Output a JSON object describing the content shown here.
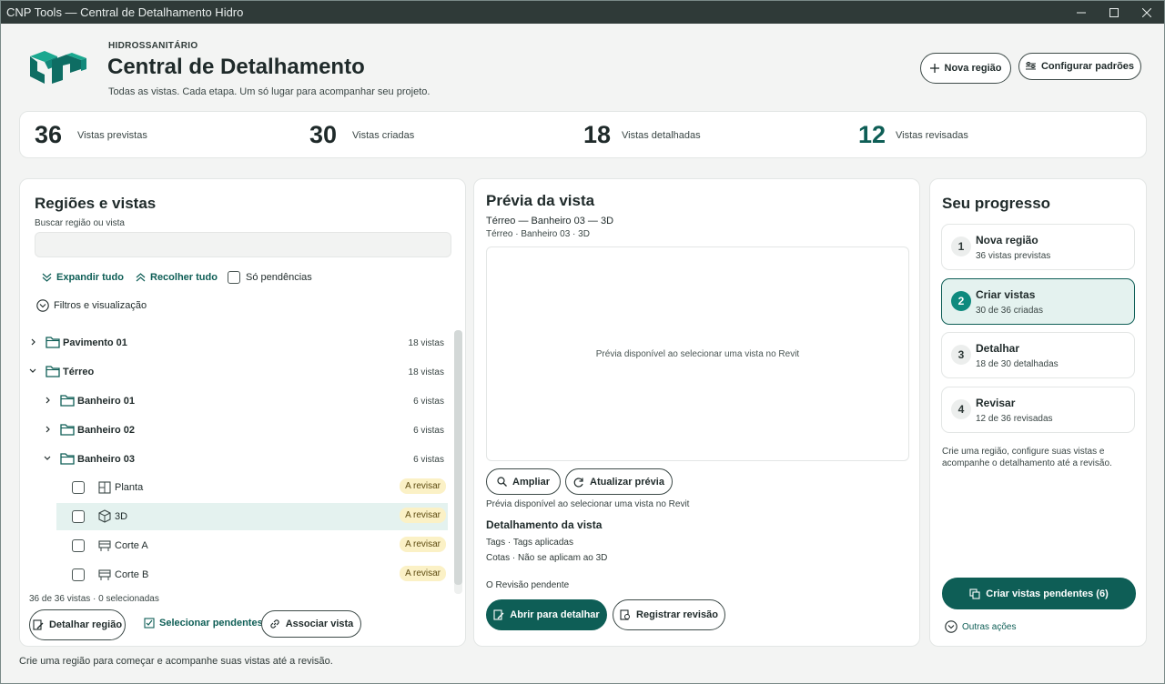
{
  "window": {
    "title": "CNP Tools — Central de Detalhamento Hidro"
  },
  "header": {
    "eyebrow": "HIDROSSANITÁRIO",
    "title": "Central de Detalhamento",
    "subtitle": "Todas as vistas. Cada etapa. Um só lugar para acompanhar seu projeto.",
    "new_region": "Nova região",
    "configure": "Configurar padrões"
  },
  "stats": [
    {
      "value": "36",
      "label": "Vistas previstas"
    },
    {
      "value": "30",
      "label": "Vistas criadas"
    },
    {
      "value": "18",
      "label": "Vistas detalhadas"
    },
    {
      "value": "12",
      "label": "Vistas revisadas"
    }
  ],
  "regions": {
    "title": "Regiões e vistas",
    "search_label": "Buscar região ou vista",
    "search_value": "",
    "expand_all": "Expandir tudo",
    "collapse_all": "Recolher tudo",
    "pending_only": "Só pendências",
    "filters": "Filtros e visualização",
    "tree": [
      {
        "label": "Pavimento 01",
        "count": "18 vistas"
      },
      {
        "label": "Térreo",
        "count": "18 vistas"
      },
      {
        "label": "Banheiro 01",
        "count": "6 vistas"
      },
      {
        "label": "Banheiro 02",
        "count": "6 vistas"
      },
      {
        "label": "Banheiro 03",
        "count": "6 vistas"
      }
    ],
    "views": [
      {
        "label": "Planta",
        "status": "A revisar"
      },
      {
        "label": "3D",
        "status": "A revisar"
      },
      {
        "label": "Corte A",
        "status": "A revisar"
      },
      {
        "label": "Corte B",
        "status": "A revisar"
      }
    ],
    "summary": "36 de 36 vistas · 0 selecionadas",
    "detail_region": "Detalhar região",
    "select_pending": "Selecionar pendentes",
    "associate_view": "Associar vista"
  },
  "preview": {
    "title": "Prévia da vista",
    "view_name": "Térreo — Banheiro 03 — 3D",
    "view_path": "Térreo · Banheiro 03 · 3D",
    "placeholder": "Prévia disponível ao selecionar uma vista no Revit",
    "zoom": "Ampliar",
    "refresh": "Atualizar prévia",
    "hint": "Prévia disponível ao selecionar uma vista no Revit",
    "detail_title": "Detalhamento da vista",
    "tags_line": "Tags · Tags aplicadas",
    "dims_line": "Cotas · Não se aplicam ao 3D",
    "review_status": "O Revisão pendente",
    "open_detail": "Abrir para detalhar",
    "register_review": "Registrar revisão"
  },
  "progress": {
    "title": "Seu progresso",
    "steps": [
      {
        "num": "1",
        "title": "Nova região",
        "sub": "36 vistas previstas"
      },
      {
        "num": "2",
        "title": "Criar vistas",
        "sub": "30 de 36 criadas"
      },
      {
        "num": "3",
        "title": "Detalhar",
        "sub": "18 de 30 detalhadas"
      },
      {
        "num": "4",
        "title": "Revisar",
        "sub": "12 de 36 revisadas"
      }
    ],
    "help": "Crie uma região, configure suas vistas e acompanhe o detalhamento até a revisão.",
    "create_pending": "Criar vistas pendentes (6)",
    "other_actions": "Outras ações"
  },
  "footer": {
    "text": "Crie uma região para começar e acompanhe suas vistas até a revisão."
  },
  "colors": {
    "accent": "#0e5e56",
    "badge_bg": "#fbf1c6",
    "selected_row": "#e4f2ef"
  }
}
